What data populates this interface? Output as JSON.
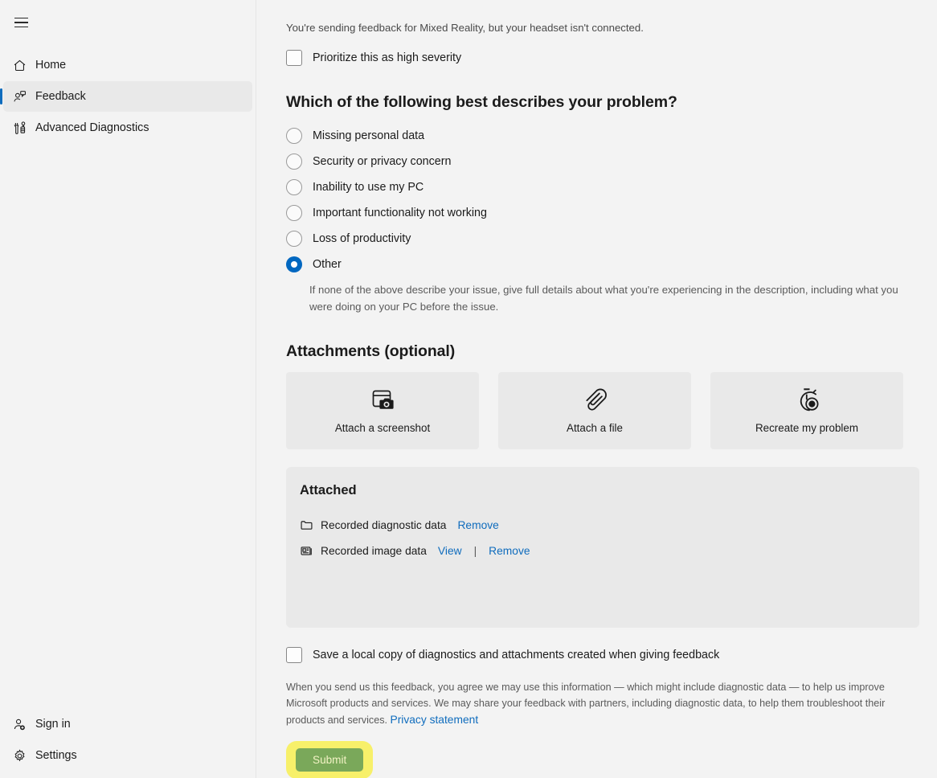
{
  "sidebar": {
    "menu_icon": "hamburger-icon",
    "items": [
      {
        "label": "Home",
        "icon": "home-icon",
        "selected": false
      },
      {
        "label": "Feedback",
        "icon": "feedback-icon",
        "selected": true
      },
      {
        "label": "Advanced Diagnostics",
        "icon": "diagnostics-icon",
        "selected": false
      }
    ],
    "bottom_items": [
      {
        "label": "Sign in",
        "icon": "add-person-icon"
      },
      {
        "label": "Settings",
        "icon": "gear-icon"
      }
    ]
  },
  "main": {
    "notice": "You're sending feedback for Mixed Reality, but your headset isn't connected.",
    "priority_checkbox": {
      "label": "Prioritize this as high severity",
      "checked": false
    },
    "problem_section": {
      "title": "Which of the following best describes your problem?",
      "options": [
        {
          "label": "Missing personal data",
          "selected": false
        },
        {
          "label": "Security or privacy concern",
          "selected": false
        },
        {
          "label": "Inability to use my PC",
          "selected": false
        },
        {
          "label": "Important functionality not working",
          "selected": false
        },
        {
          "label": "Loss of productivity",
          "selected": false
        },
        {
          "label": "Other",
          "selected": true
        }
      ],
      "help_text": "If none of the above describe your issue, give full details about what you're experiencing in the description, including what you were doing on your PC before the issue."
    },
    "attachments": {
      "title": "Attachments (optional)",
      "cards": [
        {
          "label": "Attach a screenshot",
          "icon": "screenshot-camera-icon"
        },
        {
          "label": "Attach a file",
          "icon": "paperclip-icon"
        },
        {
          "label": "Recreate my problem",
          "icon": "stopwatch-record-icon"
        }
      ]
    },
    "attached": {
      "title": "Attached",
      "items": [
        {
          "name": "Recorded diagnostic data",
          "icon": "folder-icon",
          "view_label": "",
          "remove_label": "Remove",
          "has_view": false
        },
        {
          "name": "Recorded image data",
          "icon": "image-data-icon",
          "view_label": "View",
          "remove_label": "Remove",
          "has_view": true,
          "separator": "|"
        }
      ]
    },
    "save_copy_checkbox": {
      "label": "Save a local copy of diagnostics and attachments created when giving feedback",
      "checked": false
    },
    "legal_text": "When you send us this feedback, you agree we may use this information — which might include diagnostic data — to help us improve Microsoft products and services. We may share your feedback with partners, including diagnostic data, to help them troubleshoot their products and services.",
    "privacy_link": "Privacy statement",
    "submit_label": "Submit"
  },
  "colors": {
    "accent": "#0067c0",
    "link": "#0f6cbd",
    "page_bg": "#f3f3f3",
    "card_bg": "#e9e9e9",
    "submit_bg": "#7aa85a",
    "highlight": "#f7f06a"
  }
}
